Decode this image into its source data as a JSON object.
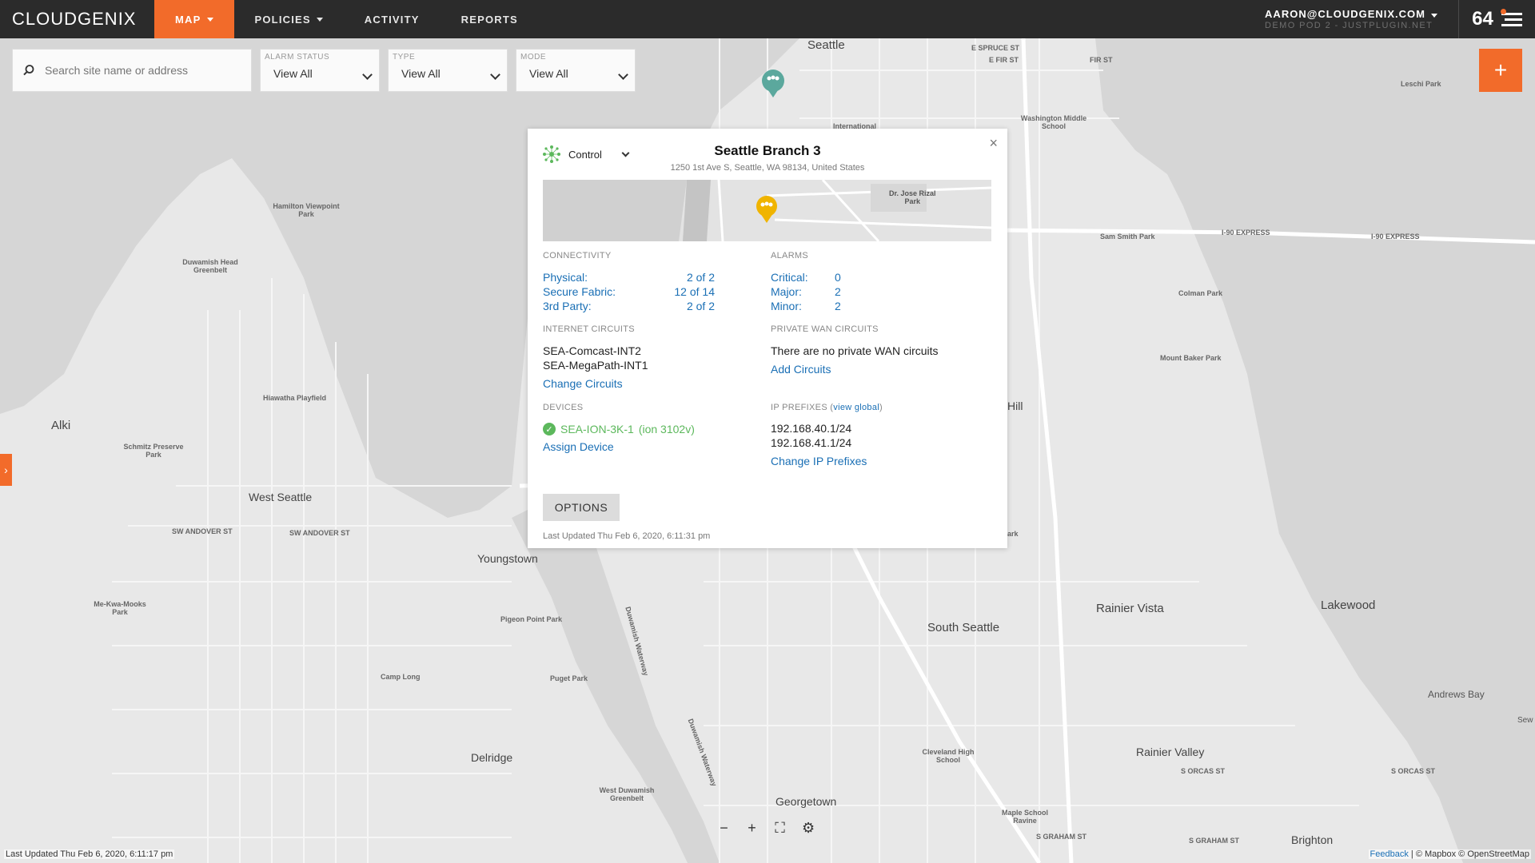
{
  "nav": {
    "logo_bold": "CLOUD",
    "logo_light": "GENIX",
    "items": [
      {
        "label": "MAP",
        "has_caret": true,
        "active": true
      },
      {
        "label": "POLICIES",
        "has_caret": true,
        "active": false
      },
      {
        "label": "ACTIVITY",
        "has_caret": false,
        "active": false
      },
      {
        "label": "REPORTS",
        "has_caret": false,
        "active": false
      }
    ],
    "user_email": "AARON@CLOUDGENIX.COM",
    "user_sub": "DEMO POD 2 - JUSTPLUGIN.NET",
    "count": "64"
  },
  "filters": {
    "search_placeholder": "Search site name or address",
    "alarm_status": {
      "label": "ALARM STATUS",
      "value": "View All"
    },
    "type": {
      "label": "TYPE",
      "value": "View All"
    },
    "mode": {
      "label": "MODE",
      "value": "View All"
    }
  },
  "add_button": "+",
  "popup": {
    "mode": "Control",
    "close": "×",
    "title": "Seattle Branch 3",
    "address": "1250 1st Ave S, Seattle, WA 98134, United States",
    "minimap_label": "Dr. Jose Rizal\nPark",
    "connectivity": {
      "label": "CONNECTIVITY",
      "rows": [
        {
          "name": "Physical:",
          "value": "2 of 2"
        },
        {
          "name": "Secure Fabric:",
          "value": "12 of 14"
        },
        {
          "name": "3rd Party:",
          "value": "2 of 2"
        }
      ]
    },
    "alarms": {
      "label": "ALARMS",
      "rows": [
        {
          "name": "Critical:",
          "value": "0"
        },
        {
          "name": "Major:",
          "value": "2"
        },
        {
          "name": "Minor:",
          "value": "2"
        }
      ]
    },
    "internet_circuits": {
      "label": "INTERNET CIRCUITS",
      "items": [
        "SEA-Comcast-INT2",
        "SEA-MegaPath-INT1"
      ],
      "action": "Change Circuits"
    },
    "private_wan": {
      "label": "PRIVATE WAN CIRCUITS",
      "empty_text": "There are no private WAN circuits",
      "action": "Add Circuits"
    },
    "devices": {
      "label": "DEVICES",
      "device_name": "SEA-ION-3K-1",
      "device_model": "(ion 3102v)",
      "action": "Assign Device"
    },
    "ip_prefixes": {
      "label_prefix": "IP PREFIXES (",
      "view_global": "view global",
      "label_suffix": ")",
      "items": [
        "192.168.40.1/24",
        "192.168.41.1/24"
      ],
      "action": "Change IP Prefixes"
    },
    "options_button": "OPTIONS",
    "last_updated": "Last Updated Thu Feb 6, 2020, 6:11:31 pm"
  },
  "map": {
    "labels": {
      "seattle": "Seattle",
      "alki": "Alki",
      "west_seattle": "West Seattle",
      "youngstown": "Youngstown",
      "delridge": "Delridge",
      "south_seattle": "South Seattle",
      "rainier_vista": "Rainier Vista",
      "lakewood": "Lakewood",
      "rainier_valley": "Rainier Valley",
      "georgetown": "Georgetown",
      "brighton": "Brighton",
      "andrews_bay": "Andrews Bay",
      "hill": "Hill",
      "hamilton": "Hamilton Viewpoint Park",
      "duwamish_head": "Duwamish Head Greenbelt",
      "hiawatha": "Hiawatha Playfield",
      "schmitz": "Schmitz Preserve Park",
      "me_kwa": "Me-Kwa-Mooks Park",
      "camp_long": "Camp Long",
      "pigeon_point": "Pigeon Point Park",
      "puget_park": "Puget Park",
      "west_duwamish": "West Duwamish Greenbelt",
      "leschi": "Leschi Park",
      "washington_middle": "Washington Middle School",
      "colman": "Colman Park",
      "mount_baker": "Mount Baker Park",
      "cleveland": "Cleveland High School",
      "maple_school": "Maple School Ravine",
      "sam_smith": "Sam Smith Park",
      "i90a": "I-90 EXPRESS",
      "i90b": "I-90 EXPRESS",
      "e_spruce": "E SPRUCE ST",
      "e_fir": "E FIR ST",
      "fir_st": "FIR ST",
      "sw_andover": "SW ANDOVER ST",
      "sw_andover2": "SW ANDOVER ST",
      "s_orcas": "S ORCAS ST",
      "s_graham": "S GRAHAM ST",
      "s_graham2": "S GRAHAM ST",
      "seward": "Sew",
      "duwamish_waterway": "Duwamish Waterway",
      "duwamish_waterway2": "Duwamish Waterway",
      "ark": "ark",
      "international": "International"
    }
  },
  "map_controls": {
    "zoom_out": "−",
    "zoom_in": "+",
    "fit": "⛶",
    "settings": "⚙"
  },
  "footer": {
    "last_updated": "Last Updated Thu Feb 6, 2020, 6:11:17 pm",
    "feedback": "Feedback",
    "attribution": "| © Mapbox © OpenStreetMap"
  },
  "colors": {
    "accent": "#f26b2a",
    "link": "#1a6fb5",
    "ok": "#5cb85c",
    "nav_bg": "#2b2b2b"
  },
  "icons": {
    "search": "search-icon",
    "menu": "menu-icon",
    "site_marker": "site-marker-icon",
    "control": "network-control-icon"
  }
}
